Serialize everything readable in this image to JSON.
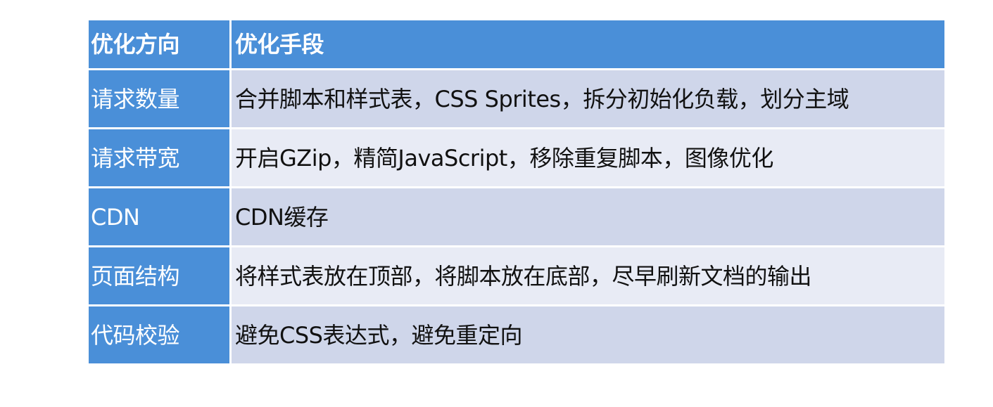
{
  "table": {
    "headers": [
      "优化方向",
      "优化手段"
    ],
    "rows": [
      [
        "请求数量",
        "合并脚本和样式表，CSS Sprites，拆分初始化负载，划分主域"
      ],
      [
        "请求带宽",
        "开启GZip，精简JavaScript，移除重复脚本，图像优化"
      ],
      [
        "CDN",
        "CDN缓存"
      ],
      [
        "页面结构",
        "将样式表放在顶部，将脚本放在底部，尽早刷新文档的输出"
      ],
      [
        "代码校验",
        "避免CSS表达式，避免重定向"
      ]
    ]
  },
  "colors": {
    "header_bg": "#4a8fd8",
    "row_odd_bg": "#cfd6ea",
    "row_even_bg": "#e8ebf5"
  }
}
